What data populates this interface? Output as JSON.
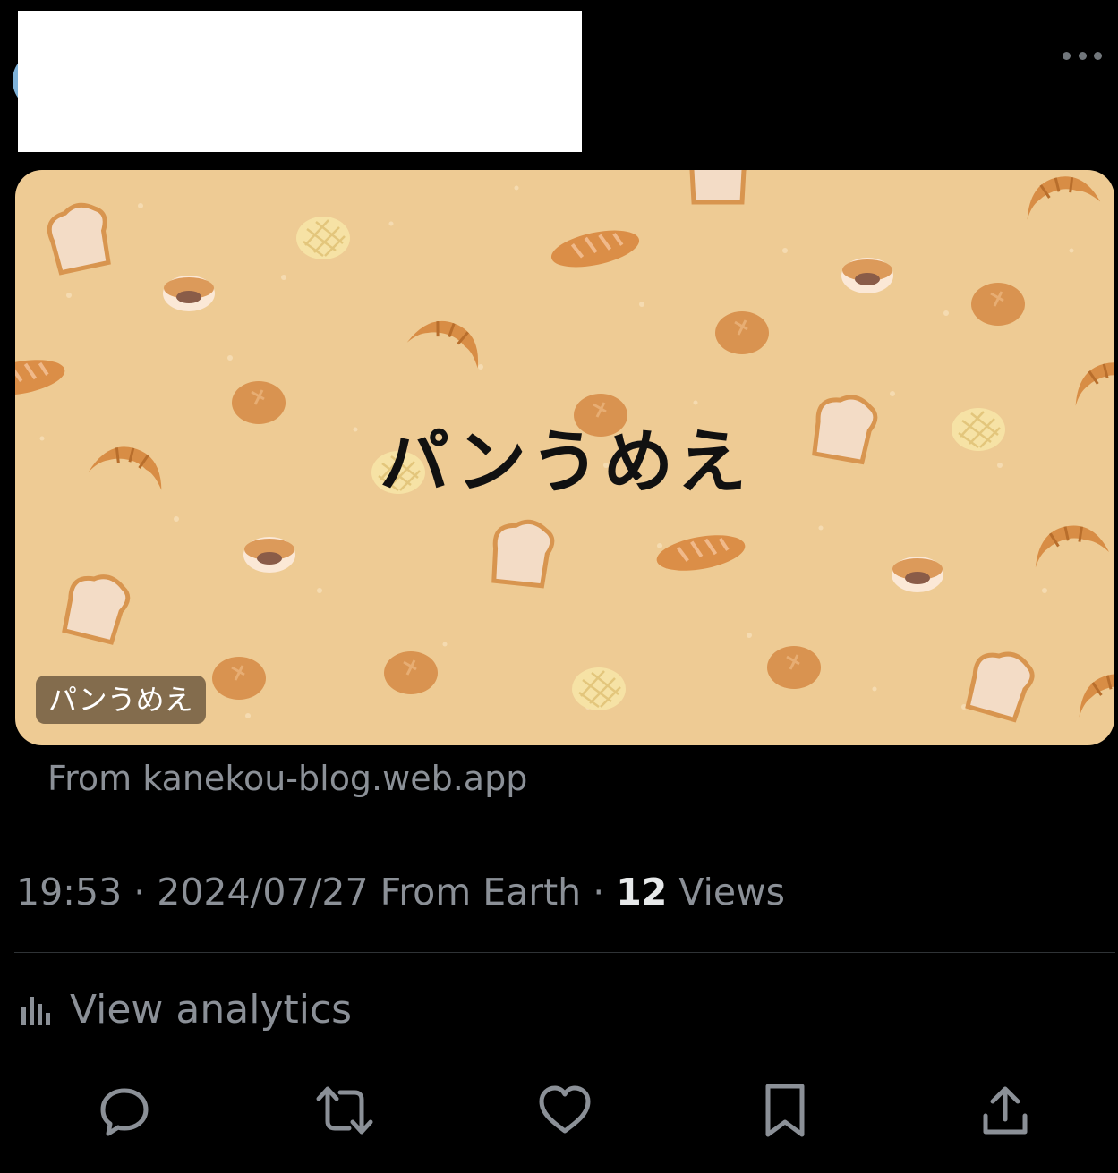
{
  "tweet": {
    "more_icon": "more-horizontal-icon",
    "card": {
      "headline": "パンうめえ",
      "badge": "パンうめえ",
      "source": "From kanekou-blog.web.app",
      "background_color": "#eecb94"
    },
    "meta": {
      "time": "19:53",
      "separator1": " · ",
      "date": "2024/07/27",
      "client": " From Earth",
      "separator2": " · ",
      "views_count": "12",
      "views_label": " Views"
    },
    "analytics": {
      "icon": "bar-chart-icon",
      "label": "View analytics"
    },
    "actions": [
      {
        "icon": "reply-icon"
      },
      {
        "icon": "retweet-icon"
      },
      {
        "icon": "like-icon"
      },
      {
        "icon": "bookmark-icon"
      },
      {
        "icon": "share-icon"
      }
    ],
    "colors": {
      "background": "#000000",
      "muted_text": "#8b9097",
      "primary_text": "#e7e9ea",
      "divider": "#2f3336"
    }
  }
}
